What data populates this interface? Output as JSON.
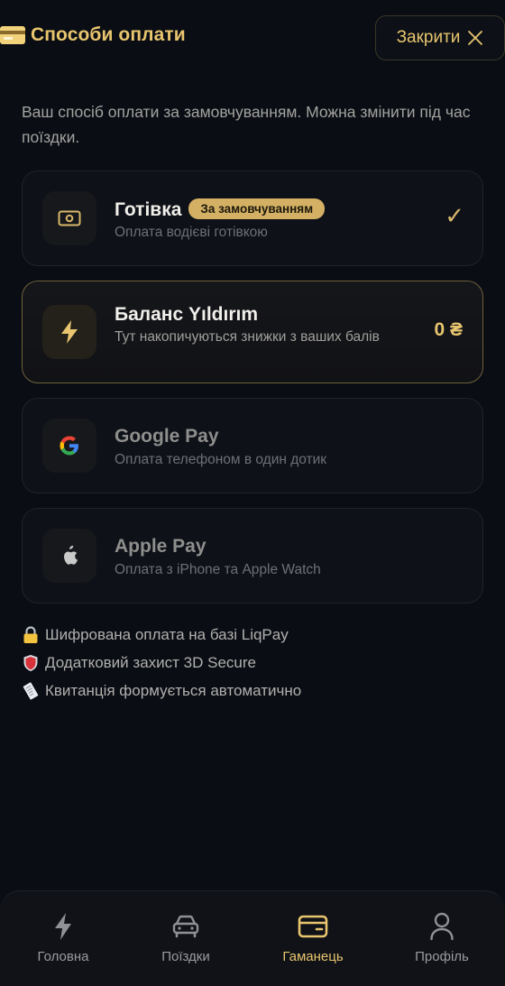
{
  "header": {
    "title": "Способи оплати",
    "title_icon": "credit-card-icon",
    "close_label": "Закрити",
    "close_icon": "close-icon"
  },
  "intro": "Ваш спосіб оплати за замовчуванням. Можна змінити під час поїздки.",
  "payment_methods": [
    {
      "title": "Готівка",
      "badge": "За замовчуванням",
      "subtitle": "Оплата водієві готівкою",
      "icon": "cash-icon",
      "selected": true,
      "check": "✓"
    },
    {
      "title": "Баланс Yıldırım",
      "subtitle": "Тут накопичуються знижки з ваших балів",
      "icon": "lightning-icon",
      "balance": "0 ₴"
    },
    {
      "title": "Google Pay",
      "subtitle": "Оплата телефоном в один дотик",
      "icon": "google-icon"
    },
    {
      "title": "Apple Pay",
      "subtitle": "Оплата з iPhone та Apple Watch",
      "icon": "apple-icon"
    }
  ],
  "features": [
    {
      "icon": "lock-icon",
      "text": "Шифрована оплата на базі LiqPay"
    },
    {
      "icon": "shield-icon",
      "text": "Додатковий захист 3D Secure"
    },
    {
      "icon": "receipt-icon",
      "text": "Квитанція формується автоматично"
    }
  ],
  "nav": {
    "items": [
      {
        "label": "Головна",
        "icon": "lightning-icon"
      },
      {
        "label": "Поїздки",
        "icon": "car-icon"
      },
      {
        "label": "Гаманець",
        "icon": "wallet-icon",
        "active": true
      },
      {
        "label": "Профіль",
        "icon": "user-icon"
      }
    ]
  },
  "colors": {
    "background": "#0a0d14",
    "accent_gold": "#e8c56e",
    "badge_bg": "#d3b064",
    "muted_text": "#6f7076"
  }
}
